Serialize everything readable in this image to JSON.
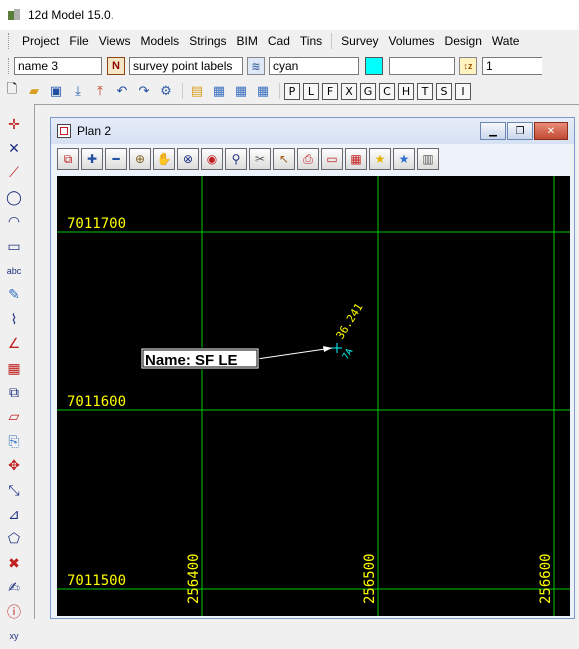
{
  "app": {
    "title": "12d Model  15.0",
    "title_suffix": "."
  },
  "menu": {
    "items": [
      "Project",
      "File",
      "Views",
      "Models",
      "Strings",
      "BIM",
      "Cad",
      "Tins"
    ],
    "items2": [
      "Survey",
      "Volumes",
      "Design",
      "Wate"
    ]
  },
  "props": {
    "name_value": "name 3",
    "n_button": "N",
    "style_value": "survey point labels",
    "colour_value": "cyan",
    "colour_swatch": "#00ffff",
    "z_value": "",
    "weight_value": "1"
  },
  "letter_buttons": [
    "P",
    "L",
    "F",
    "X",
    "G",
    "C",
    "H",
    "T",
    "S",
    "I"
  ],
  "plan": {
    "title": "Plan 2",
    "northings": [
      "7011700",
      "7011600",
      "7011500"
    ],
    "eastings": [
      "256400",
      "256500",
      "256600"
    ],
    "label_box": "Name: SF LE",
    "point_height": "36.241",
    "point_id": "7A",
    "grid_color": "#00c800",
    "text_color": "#ffff00",
    "point_color": "#00ffff"
  }
}
